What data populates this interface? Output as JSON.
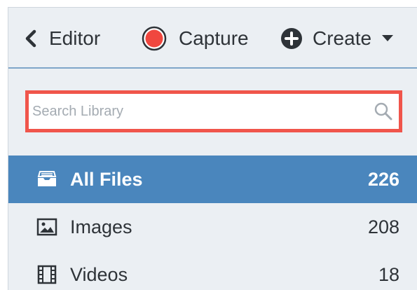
{
  "toolbar": {
    "editor_label": "Editor",
    "capture_label": "Capture",
    "create_label": "Create",
    "capture_color": "#f0473f",
    "icons": {
      "editor": "chevron-left-icon",
      "capture": "record-icon",
      "create": "plus-circle-icon",
      "create_menu": "caret-down-icon"
    }
  },
  "search": {
    "placeholder": "Search Library",
    "value": "",
    "highlight_color": "#f0554b",
    "icon": "search-icon"
  },
  "library": {
    "items": [
      {
        "label": "All Files",
        "count": "226",
        "icon": "inbox-icon",
        "selected": true
      },
      {
        "label": "Images",
        "count": "208",
        "icon": "image-icon",
        "selected": false
      },
      {
        "label": "Videos",
        "count": "18",
        "icon": "film-icon",
        "selected": false
      }
    ],
    "selected_color": "#4a86bd"
  }
}
